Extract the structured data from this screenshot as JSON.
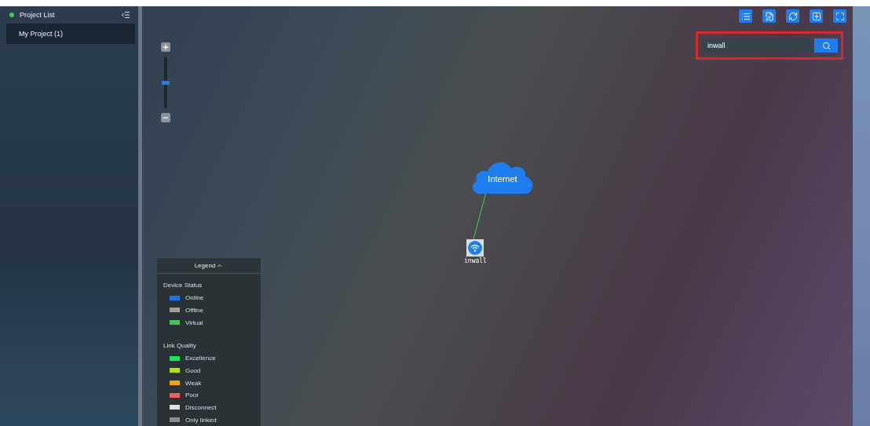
{
  "sidebar": {
    "title": "Project List",
    "projects": [
      {
        "label": "My Project (1)",
        "selected": true
      }
    ]
  },
  "zoom": {
    "level": 0.5
  },
  "search": {
    "value": "inwall"
  },
  "topology": {
    "cloud_label": "Internet",
    "device_label": "inwall"
  },
  "legend": {
    "title": "Legend",
    "sections": [
      {
        "heading": "Device Status",
        "items": [
          {
            "label": "Online",
            "color": "#1a73e8"
          },
          {
            "label": "Offline",
            "color": "#9e9e9e"
          },
          {
            "label": "Virtual",
            "color": "#4cc35a"
          }
        ]
      },
      {
        "heading": "Link Quality",
        "items": [
          {
            "label": "Excellence",
            "color": "#19e35a"
          },
          {
            "label": "Good",
            "color": "#b5e00a"
          },
          {
            "label": "Weak",
            "color": "#f0a30a"
          },
          {
            "label": "Poor",
            "color": "#f06060"
          },
          {
            "label": "Disconnect",
            "color": "#dedede"
          },
          {
            "label": "Only linked",
            "color": "#8c8c8c"
          }
        ]
      }
    ]
  }
}
